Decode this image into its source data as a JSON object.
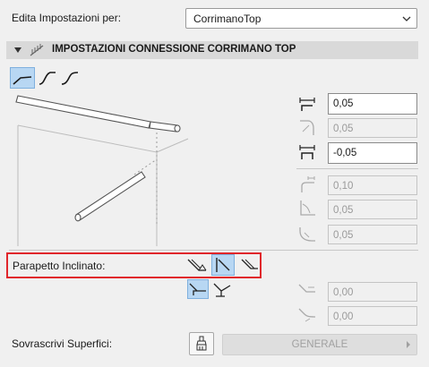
{
  "header": {
    "label": "Edita Impostazioni per:",
    "select_value": "CorrimanoTop"
  },
  "section": {
    "title": "IMPOSTAZIONI CONNESSIONE CORRIMANO TOP"
  },
  "fields": {
    "offset_h": "0,05",
    "radius_1": "0,05",
    "offset_v": "-0,05",
    "extension": "0,10",
    "radius_2": "0,05",
    "radius_3": "0,05",
    "slope_val_1": "0,00",
    "slope_val_2": "0,00"
  },
  "parapetto": {
    "label": "Parapetto Inclinato:"
  },
  "footer": {
    "label": "Sovrascrivi Superfici:",
    "button_label": "GENERALE"
  },
  "colors": {
    "highlight_border": "#e0262b",
    "selected_bg": "#b8d7f3"
  }
}
